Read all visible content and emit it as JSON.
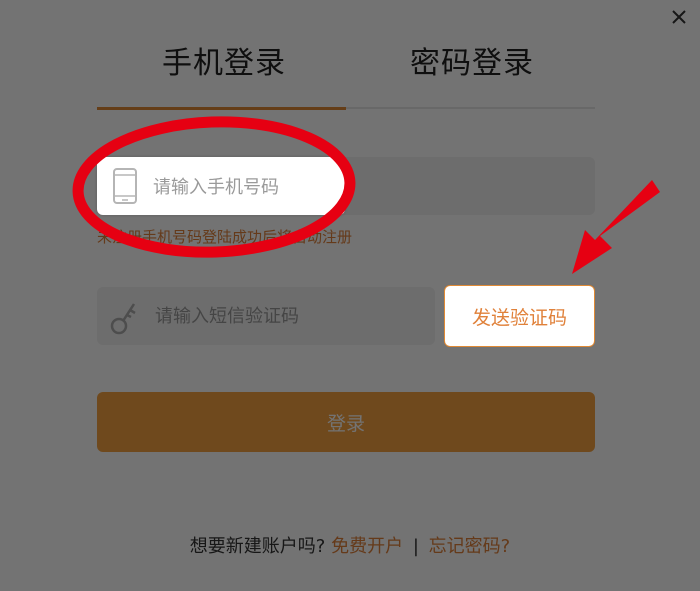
{
  "tabs": {
    "phone_login": "手机登录",
    "password_login": "密码登录"
  },
  "phone_input": {
    "placeholder": "请输入手机号码",
    "value": ""
  },
  "hint": "未注册手机号码登陆成功后将自动注册",
  "sms_input": {
    "placeholder": "请输入短信验证码",
    "value": ""
  },
  "send_code_label": "发送验证码",
  "login_label": "登录",
  "footer": {
    "prompt": "想要新建账户吗?",
    "signup_link": "免费开户",
    "separator": "|",
    "forgot_link": "忘记密码?"
  },
  "colors": {
    "accent": "#e0813a",
    "login_button": "#f7a240",
    "annotation_red": "#e60012"
  },
  "icons": [
    "close-icon",
    "phone-icon",
    "key-icon",
    "arrow-annotation"
  ]
}
